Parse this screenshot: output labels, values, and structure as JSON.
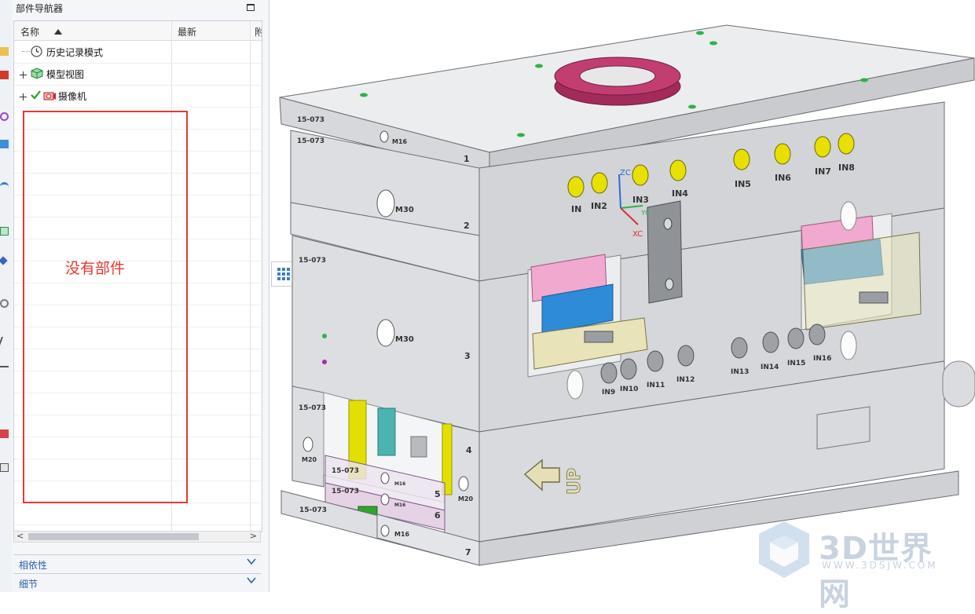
{
  "navigator": {
    "title": "部件导航器",
    "columns": {
      "name": "名称",
      "latest": "最新",
      "third": "附"
    },
    "rows": [
      {
        "label": "历史记录模式",
        "icon": "clock-icon",
        "expandable": false
      },
      {
        "label": "模型视图",
        "icon": "model-view-icon",
        "expandable": true
      },
      {
        "label": "摄像机",
        "icon": "camera-icon",
        "expandable": true
      }
    ],
    "annotation": "没有部件",
    "sections": {
      "dependencies": "相依性",
      "details": "细节"
    },
    "scroll_left": "<",
    "scroll_right": ">"
  },
  "viewport": {
    "plate_code": "15-073",
    "plate_numbers": [
      "1",
      "2",
      "3",
      "4",
      "5",
      "6",
      "7"
    ],
    "bolt_labels": {
      "m16": "M16",
      "m30": "M30",
      "m20": "M20"
    },
    "inlet_labels_top": [
      "IN",
      "IN2",
      "IN3",
      "IN4",
      "IN5",
      "IN6",
      "IN7",
      "IN8"
    ],
    "inlet_labels_bottom": [
      "IN9",
      "IN10",
      "IN11",
      "IN12",
      "IN13",
      "IN14",
      "IN15",
      "IN16"
    ],
    "axes": {
      "z": "ZC",
      "y": "YC",
      "x": "XC"
    },
    "up_label": "UP"
  },
  "watermark": {
    "brand": "3D世界网",
    "site": "WWW.3DSJW.COM"
  },
  "colors": {
    "annotation_red": "#e8382f",
    "link_blue": "#2b5fad",
    "inlet_yellow": "#e8e000",
    "flange": "#b8336a",
    "check_green": "#21a121"
  }
}
